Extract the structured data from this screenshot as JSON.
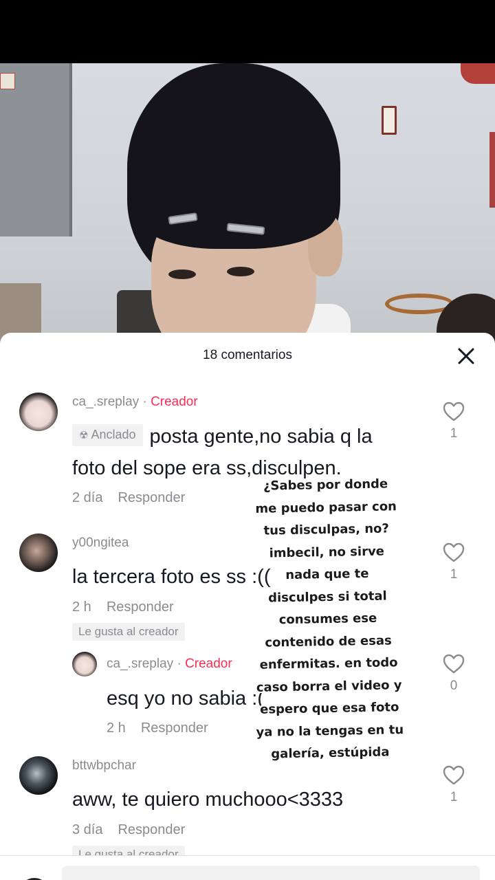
{
  "sheet": {
    "title": "18 comentarios"
  },
  "comments": [
    {
      "username": "ca_.sreplay",
      "separator": "·",
      "creator_badge": "Creador",
      "pinned_label": "Anclado",
      "text_line1": "posta gente,no sabia q la",
      "text_line2": "foto del sope era ss,disculpen.",
      "time": "2 día",
      "reply_label": "Responder",
      "likes": "1"
    },
    {
      "username": "y00ngitea",
      "text": "la tercera foto es ss :((",
      "time": "2 h",
      "reply_label": "Responder",
      "creator_liked": "Le gusta al creador",
      "likes": "1"
    },
    {
      "username": "ca_.sreplay",
      "separator": "·",
      "creator_badge": "Creador",
      "text": "esq yo no sabia :(",
      "time": "2 h",
      "reply_label": "Responder",
      "likes": "0"
    },
    {
      "username": "bttwbpchar",
      "text": "aww, te quiero muchooo<3333",
      "time": "3 día",
      "reply_label": "Responder",
      "creator_liked": "Le gusta al creador",
      "likes": "1"
    }
  ],
  "overlay_text": "¿Sabes por donde\nme puedo pasar con\ntus disculpas, no?\nimbecil, no sirve\nnada que te\ndisculpes si total\nconsumes ese\ncontenido de esas\nenfermitas. en todo\ncaso borra el video y\nespero que esa foto\nya no la tengas en tu\ngalería, estúpida",
  "icons": {
    "close": "close-icon",
    "heart": "heart-outline-icon",
    "pin": "pin-icon"
  },
  "colors": {
    "creator": "#fe2c55",
    "secondary_text": "#8a8b91",
    "primary_text": "#161823"
  }
}
